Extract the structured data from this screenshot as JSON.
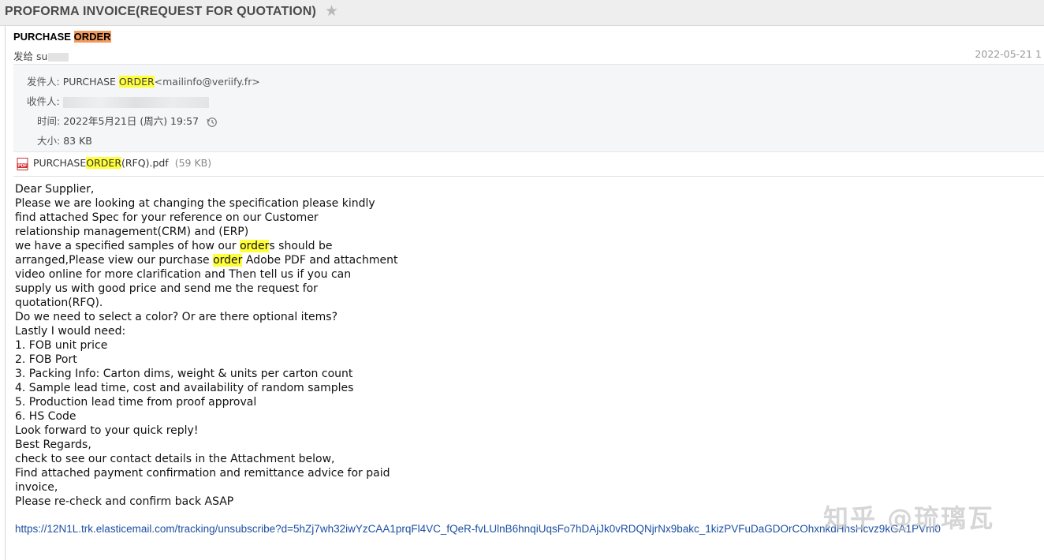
{
  "window": {
    "title": "PROFORMA INVOICE(REQUEST FOR QUOTATION)"
  },
  "email": {
    "subject_a": "PURCHASE ",
    "subject_b": "ORDER",
    "sendto_label": "发给 su",
    "date_short": "2022-05-21 1",
    "from_label": "发件人: ",
    "from_name_a": "PURCHASE ",
    "from_name_b": "ORDER",
    "from_addr": "<mailinfo@veriify.fr>",
    "to_label": "收件人: ",
    "time_label": "时间: ",
    "time_value": "2022年5月21日 (周六) 19:57",
    "size_label": "大小: ",
    "size_value": "83 KB"
  },
  "attachment": {
    "name_a": "PURCHASE",
    "name_b": "ORDER",
    "name_c": "(RFQ).pdf",
    "size": "(59 KB)"
  },
  "body": {
    "l1": "Dear Supplier,",
    "l2": "Please we are looking at changing the specification please kindly",
    "l3": "find attached Spec for your reference on our Customer",
    "l4": "relationship management(CRM) and (ERP)",
    "l5a": "we have a specified samples of how our ",
    "l5b": "order",
    "l5c": "s should be",
    "l6a": "arranged,Please view our purchase ",
    "l6b": "order",
    "l6c": " Adobe PDF and attachment",
    "l7": "video online for more clarification and Then tell us if you can",
    "l8": "supply us with good price and send me the request for",
    "l9": "quotation(RFQ).",
    "l10": "Do we need to select a color? Or are there optional items?",
    "l11": "Lastly I would need:",
    "l12": "1. FOB unit price",
    "l13": "2. FOB Port",
    "l14": "3. Packing Info: Carton dims, weight & units per carton count",
    "l15": "4. Sample lead time, cost and availability of random samples",
    "l16": "5. Production lead time from proof approval",
    "l17": "6. HS Code",
    "l18": "Look forward to your quick reply!",
    "l19": "Best Regards,",
    "l20": "check to see our contact details in the Attachment below,",
    "l21": "Find attached payment confirmation and remittance advice for paid",
    "l22": "invoice,",
    "l23": "Please re-check and confirm back ASAP",
    "link": "https://12N1L.trk.elasticemail.com/tracking/unsubscribe?d=5hZj7wh32iwYzCAA1prqFl4VC_fQeR-fvLUlnB6hnqiUqsFo7hDAjJk0vRDQNjrNx9bakc_1kizPVFuDaGDOrCOhxnkdHhsHcvz9kGA1PVm0"
  },
  "watermark": "知乎 @琉璃瓦",
  "colors": {
    "highlight_orange": "#f39b5e",
    "highlight_yellow": "#ffff3c",
    "link": "#1b4ea3"
  }
}
